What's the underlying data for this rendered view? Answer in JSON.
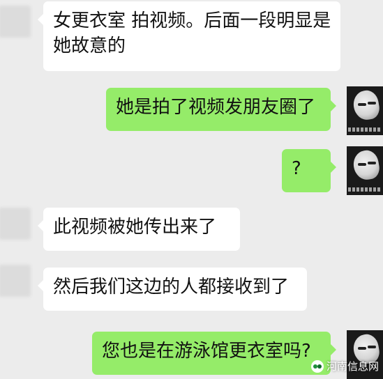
{
  "chat": {
    "messages": [
      {
        "side": "incoming",
        "lines": [
          "女更衣室 拍视频。后面一段明显是",
          "她故意的"
        ]
      },
      {
        "side": "outgoing",
        "text": "她是拍了视频发朋友圈了"
      },
      {
        "side": "outgoing",
        "text": "?"
      },
      {
        "side": "incoming",
        "text": "此视频被她传出来了"
      },
      {
        "side": "incoming",
        "text": "然后我们这边的人都接收到了"
      },
      {
        "side": "outgoing",
        "text": "您也是在游泳馆更衣室吗?"
      }
    ]
  },
  "watermark": {
    "text": "河南信息网",
    "icon": "wechat-icon"
  },
  "colors": {
    "background": "#ececec",
    "incoming_bubble": "#ffffff",
    "outgoing_bubble": "#95ec69"
  }
}
